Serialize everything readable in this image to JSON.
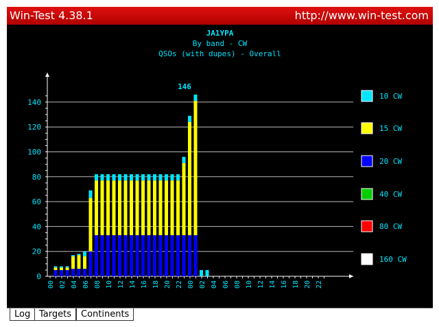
{
  "window": {
    "title": "Win-Test 4.38.1",
    "url": "http://www.win-test.com"
  },
  "tabs": [
    {
      "label": "Log"
    },
    {
      "label": "Targets"
    },
    {
      "label": "Continents"
    }
  ],
  "chart_data": {
    "type": "bar",
    "stacked": true,
    "title": "JA1YPA",
    "subtitle": "By band - CW",
    "subtitle2": "QSOs (with dupes) - Overall",
    "ylim": [
      0,
      150
    ],
    "yticks": [
      0,
      20,
      40,
      60,
      80,
      100,
      120,
      140
    ],
    "xtick_labels": [
      "00",
      "02",
      "04",
      "06",
      "08",
      "10",
      "12",
      "14",
      "16",
      "18",
      "20",
      "22",
      "00",
      "02",
      "04",
      "06",
      "08",
      "10",
      "12",
      "14",
      "16",
      "18",
      "20",
      "22"
    ],
    "peak_label": "146",
    "grid": true,
    "legend_position": "right",
    "series": [
      {
        "name": "10 CW",
        "color": "#00e5ff",
        "values": [
          0,
          1,
          1,
          1,
          1,
          1,
          4,
          6,
          5,
          5,
          5,
          5,
          5,
          5,
          5,
          5,
          5,
          5,
          5,
          5,
          5,
          5,
          5,
          5,
          5,
          5,
          5,
          5
        ]
      },
      {
        "name": "15 CW",
        "color": "#ffff00",
        "values": [
          0,
          2,
          2,
          2,
          10,
          11,
          10,
          43,
          44,
          44,
          44,
          44,
          44,
          44,
          44,
          44,
          44,
          44,
          44,
          44,
          44,
          44,
          44,
          58,
          91,
          108,
          0,
          0
        ]
      },
      {
        "name": "20 CW",
        "color": "#0000ff",
        "values": [
          0,
          5,
          5,
          5,
          6,
          6,
          6,
          20,
          33,
          33,
          33,
          33,
          33,
          33,
          33,
          33,
          33,
          33,
          33,
          33,
          33,
          33,
          33,
          33,
          33,
          33,
          0,
          0
        ]
      },
      {
        "name": "40 CW",
        "color": "#00cc00",
        "values": []
      },
      {
        "name": "80 CW",
        "color": "#ff0000",
        "values": []
      },
      {
        "name": "160 CW",
        "color": "#ffffff",
        "values": []
      }
    ]
  }
}
